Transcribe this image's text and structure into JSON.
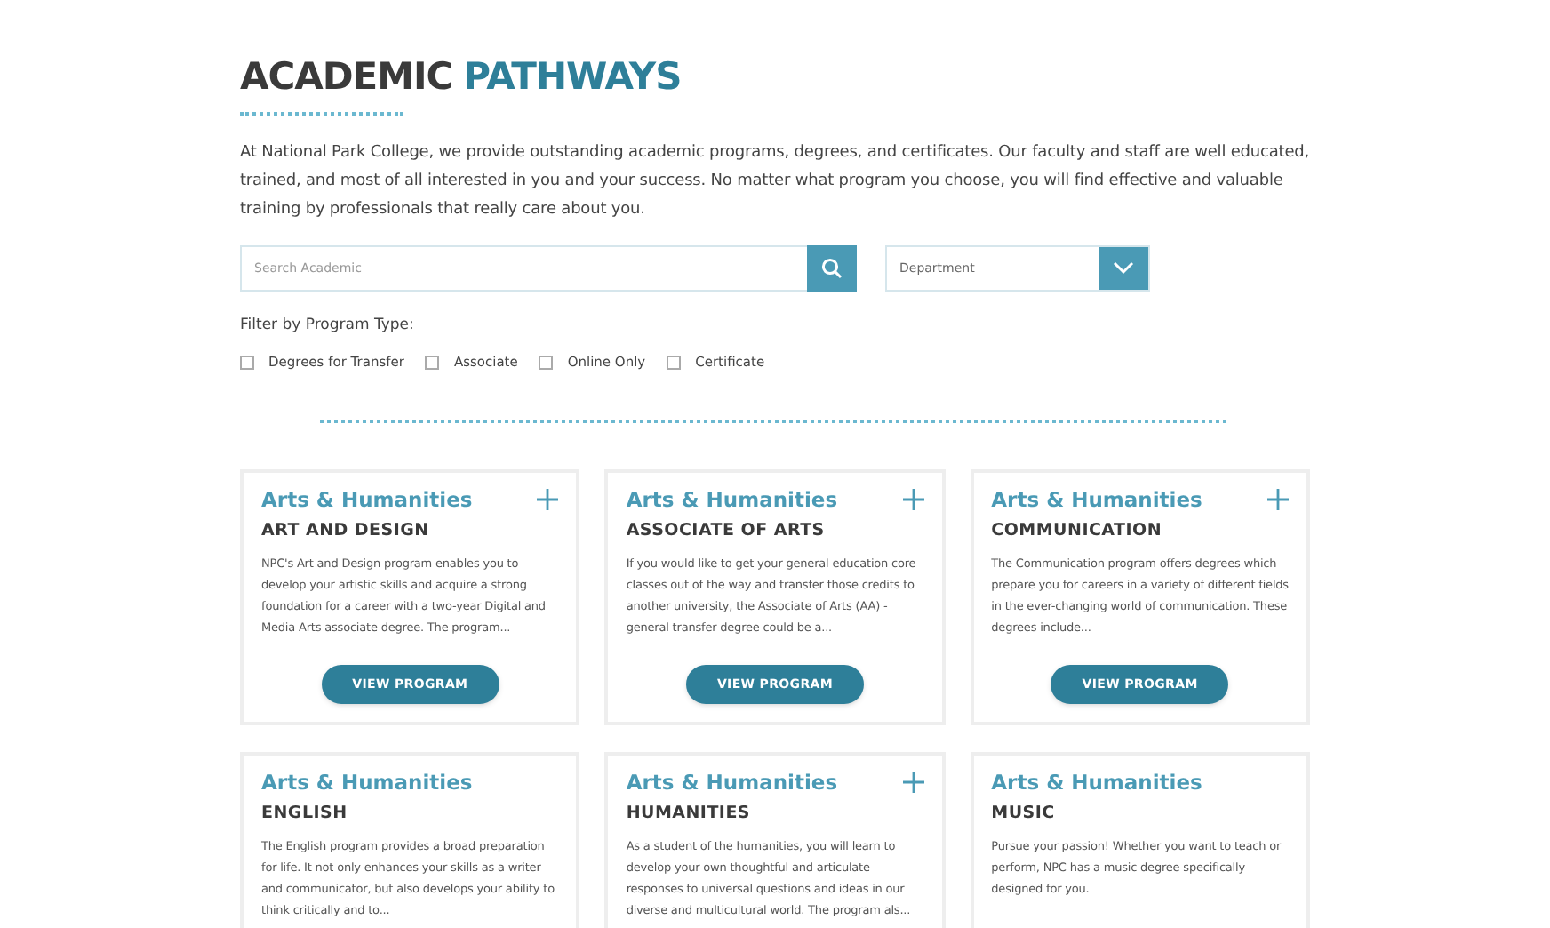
{
  "heading": {
    "first": "ACADEMIC",
    "second": "PATHWAYS"
  },
  "intro": "At National Park College, we provide outstanding academic programs, degrees, and certificates. Our faculty and staff are well educated, trained, and most of all interested in you and your success. No matter what program you choose, you will find effective and valuable training by professionals that really care about you.",
  "search": {
    "placeholder": "Search Academic"
  },
  "department": {
    "placeholder": "Department"
  },
  "filter": {
    "label": "Filter by Program Type:",
    "options": [
      {
        "label": "Degrees for Transfer",
        "checked": false
      },
      {
        "label": "Associate",
        "checked": false
      },
      {
        "label": "Online Only",
        "checked": false
      },
      {
        "label": "Certificate",
        "checked": false
      }
    ]
  },
  "programs": [
    {
      "category": "Arts & Humanities",
      "expandable": true,
      "title": "ART AND DESIGN",
      "description": "NPC's Art and Design program enables you to develop your artistic skills and acquire a strong foundation for a career with a two-year Digital and Media Arts associate degree. The program...",
      "button": "VIEW PROGRAM"
    },
    {
      "category": "Arts & Humanities",
      "expandable": true,
      "title": "ASSOCIATE OF ARTS",
      "description": "If you would like to get your general education core classes out of the way and transfer those credits to another university, the Associate of Arts (AA) - general transfer degree could be a...",
      "button": "VIEW PROGRAM"
    },
    {
      "category": "Arts & Humanities",
      "expandable": true,
      "title": "COMMUNICATION",
      "description": "The Communication program offers degrees which prepare you for careers in a variety of different fields in the ever-changing world of communication. These degrees include...",
      "button": "VIEW PROGRAM"
    },
    {
      "category": "Arts & Humanities",
      "expandable": false,
      "title": "ENGLISH",
      "description": "The English program provides a broad preparation for life. It not only enhances your skills as a writer and communicator, but also develops your ability to think critically and to..."
    },
    {
      "category": "Arts & Humanities",
      "expandable": true,
      "title": "HUMANITIES",
      "description": "As a student of the humanities, you will learn to develop your own thoughtful and articulate responses to universal questions and ideas in our diverse and multicultural world. The program als..."
    },
    {
      "category": "Arts & Humanities",
      "expandable": false,
      "title": "MUSIC",
      "description": "Pursue your passion! Whether you want to teach or perform, NPC has a music degree specifically designed for you."
    }
  ]
}
